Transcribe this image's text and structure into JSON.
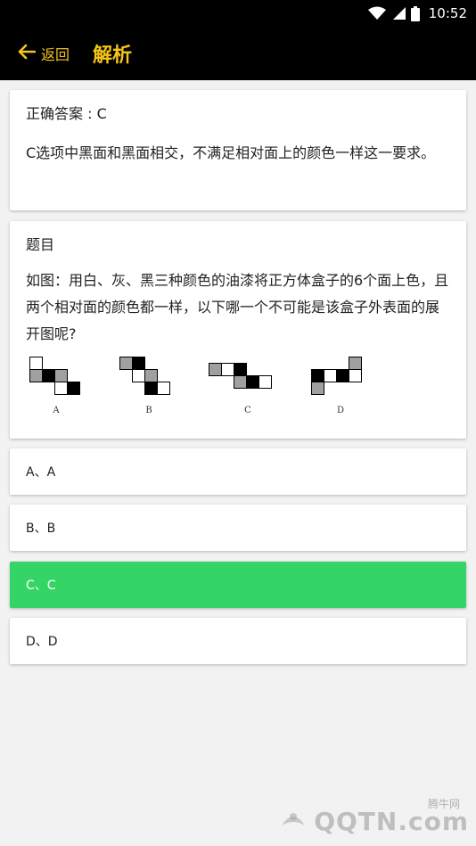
{
  "status_bar": {
    "time": "10:52"
  },
  "app_bar": {
    "back_label": "返回",
    "title": "解析"
  },
  "answer": {
    "title": "正确答案 : C",
    "explanation": "C选项中黑面和黑面相交，不满足相对面上的颜色一样这一要求。"
  },
  "question": {
    "label": "题目",
    "text": "如图：用白、灰、黑三种颜色的油漆将正方体盒子的6个面上色，且两个相对面的颜色都一样，以下哪一个不可能是该盒子外表面的展开图呢?",
    "figure_labels": [
      "A",
      "B",
      "C",
      "D"
    ]
  },
  "options": [
    {
      "label": "A、A",
      "selected": false
    },
    {
      "label": "B、B",
      "selected": false
    },
    {
      "label": "C、C",
      "selected": true
    },
    {
      "label": "D、D",
      "selected": false
    }
  ],
  "watermark": {
    "main": "QQTN.com",
    "sub": "腾牛网"
  },
  "colors": {
    "accent": "#f5c518",
    "selected": "#35d466",
    "black": "#000000"
  }
}
